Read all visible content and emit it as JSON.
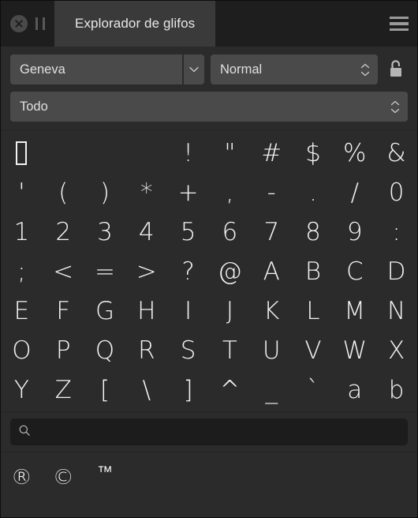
{
  "window": {
    "background_color": "#2b2b2b",
    "titlebar_color": "#1e1e1e",
    "accent_text_color": "#f2f2f2"
  },
  "titlebar": {
    "close_icon": "close-circle-icon",
    "pause_icon": "pause-icon",
    "tab_title": "Explorador de glifos",
    "menu_icon": "hamburger-menu-icon"
  },
  "controls": {
    "font_family": {
      "value": "Geneva",
      "dropdown_icon": "chevron-down-icon"
    },
    "font_style": {
      "value": "Normal",
      "stepper_icon": "chevron-up-down-icon"
    },
    "lock": {
      "icon": "unlock-icon",
      "state": "unlocked"
    },
    "glyph_filter": {
      "value": "Todo",
      "stepper_icon": "chevron-up-down-icon"
    }
  },
  "glyph_grid": {
    "columns": 10,
    "cells": [
      {
        "glyph": "",
        "type": "notdef"
      },
      {
        "glyph": "",
        "type": "blank"
      },
      {
        "glyph": "",
        "type": "blank"
      },
      {
        "glyph": "",
        "type": "blank"
      },
      {
        "glyph": "!",
        "type": "glyph"
      },
      {
        "glyph": "\"",
        "type": "glyph"
      },
      {
        "glyph": "#",
        "type": "glyph"
      },
      {
        "glyph": "$",
        "type": "glyph"
      },
      {
        "glyph": "%",
        "type": "glyph"
      },
      {
        "glyph": "&",
        "type": "glyph"
      },
      {
        "glyph": "'",
        "type": "glyph"
      },
      {
        "glyph": "(",
        "type": "glyph"
      },
      {
        "glyph": ")",
        "type": "glyph"
      },
      {
        "glyph": "*",
        "type": "glyph"
      },
      {
        "glyph": "+",
        "type": "glyph"
      },
      {
        "glyph": ",",
        "type": "glyph"
      },
      {
        "glyph": "-",
        "type": "glyph"
      },
      {
        "glyph": ".",
        "type": "glyph"
      },
      {
        "glyph": "/",
        "type": "glyph"
      },
      {
        "glyph": "0",
        "type": "glyph"
      },
      {
        "glyph": "1",
        "type": "glyph"
      },
      {
        "glyph": "2",
        "type": "glyph"
      },
      {
        "glyph": "3",
        "type": "glyph"
      },
      {
        "glyph": "4",
        "type": "glyph"
      },
      {
        "glyph": "5",
        "type": "glyph"
      },
      {
        "glyph": "6",
        "type": "glyph"
      },
      {
        "glyph": "7",
        "type": "glyph"
      },
      {
        "glyph": "8",
        "type": "glyph"
      },
      {
        "glyph": "9",
        "type": "glyph"
      },
      {
        "glyph": ":",
        "type": "glyph"
      },
      {
        "glyph": ";",
        "type": "glyph"
      },
      {
        "glyph": "<",
        "type": "glyph"
      },
      {
        "glyph": "=",
        "type": "glyph"
      },
      {
        "glyph": ">",
        "type": "glyph"
      },
      {
        "glyph": "?",
        "type": "glyph"
      },
      {
        "glyph": "@",
        "type": "glyph"
      },
      {
        "glyph": "A",
        "type": "glyph"
      },
      {
        "glyph": "B",
        "type": "glyph"
      },
      {
        "glyph": "C",
        "type": "glyph"
      },
      {
        "glyph": "D",
        "type": "glyph"
      },
      {
        "glyph": "E",
        "type": "glyph"
      },
      {
        "glyph": "F",
        "type": "glyph"
      },
      {
        "glyph": "G",
        "type": "glyph"
      },
      {
        "glyph": "H",
        "type": "glyph"
      },
      {
        "glyph": "I",
        "type": "glyph"
      },
      {
        "glyph": "J",
        "type": "glyph"
      },
      {
        "glyph": "K",
        "type": "glyph"
      },
      {
        "glyph": "L",
        "type": "glyph"
      },
      {
        "glyph": "M",
        "type": "glyph"
      },
      {
        "glyph": "N",
        "type": "glyph"
      },
      {
        "glyph": "O",
        "type": "glyph"
      },
      {
        "glyph": "P",
        "type": "glyph"
      },
      {
        "glyph": "Q",
        "type": "glyph"
      },
      {
        "glyph": "R",
        "type": "glyph"
      },
      {
        "glyph": "S",
        "type": "glyph"
      },
      {
        "glyph": "T",
        "type": "glyph"
      },
      {
        "glyph": "U",
        "type": "glyph"
      },
      {
        "glyph": "V",
        "type": "glyph"
      },
      {
        "glyph": "W",
        "type": "glyph"
      },
      {
        "glyph": "X",
        "type": "glyph"
      },
      {
        "glyph": "Y",
        "type": "glyph"
      },
      {
        "glyph": "Z",
        "type": "glyph"
      },
      {
        "glyph": "[",
        "type": "glyph"
      },
      {
        "glyph": "\\",
        "type": "glyph"
      },
      {
        "glyph": "]",
        "type": "glyph"
      },
      {
        "glyph": "^",
        "type": "glyph"
      },
      {
        "glyph": "_",
        "type": "glyph"
      },
      {
        "glyph": "`",
        "type": "glyph"
      },
      {
        "glyph": "a",
        "type": "glyph"
      },
      {
        "glyph": "b",
        "type": "glyph"
      }
    ]
  },
  "search": {
    "icon": "search-icon",
    "value": "",
    "placeholder": ""
  },
  "variants": {
    "columns": 10,
    "cells": [
      {
        "glyph": "®",
        "type": "glyph"
      },
      {
        "glyph": "©",
        "type": "glyph"
      },
      {
        "glyph": "™",
        "type": "tm"
      }
    ]
  }
}
